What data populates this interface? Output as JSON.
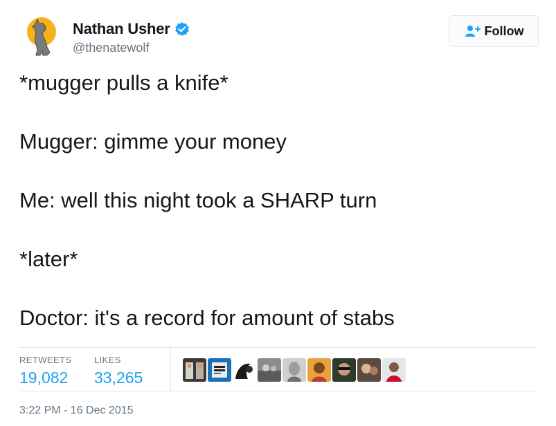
{
  "header": {
    "display_name": "Nathan Usher",
    "handle": "@thenatewolf",
    "avatar_icon": "howling-wolf-avatar",
    "verified_icon": "verified-badge-icon",
    "follow_label": "Follow",
    "follow_icon": "add-user-icon"
  },
  "tweet": {
    "lines": [
      "*mugger pulls a knife*",
      "Mugger: gimme your money",
      "Me: well this night took a SHARP turn",
      "*later*",
      "Doctor: it's a record for amount of stabs"
    ]
  },
  "stats": {
    "retweets_label": "RETWEETS",
    "retweets_value": "19,082",
    "likes_label": "LIKES",
    "likes_value": "33,265"
  },
  "likers": [
    "liker-avatar-1",
    "liker-avatar-2",
    "liker-avatar-3",
    "liker-avatar-4",
    "liker-avatar-5",
    "liker-avatar-6",
    "liker-avatar-7",
    "liker-avatar-8",
    "liker-avatar-9"
  ],
  "timestamp": "3:22 PM - 16 Dec 2015",
  "colors": {
    "accent": "#1da1f2",
    "text": "#14171a",
    "muted": "#657786",
    "border": "#e1e8ed",
    "verified": "#1da1f2"
  }
}
